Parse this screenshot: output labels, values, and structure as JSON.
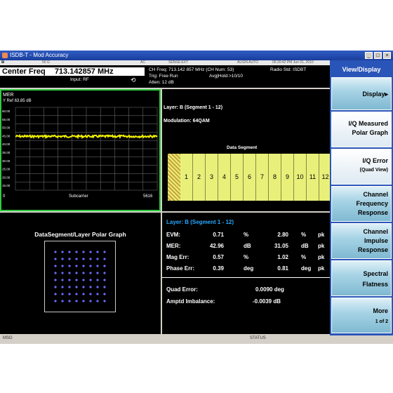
{
  "window": {
    "title": "ISDB-T - Mod Accuracy",
    "buttons": [
      "_",
      "□",
      "×"
    ]
  },
  "info_strip": {
    "mode": "50 Ω",
    "coupling": "AC",
    "sense": "SENSE:EXT",
    "align": "ALIGN AUTO",
    "datetime": "05:20:42 PM Jun 01, 2010"
  },
  "header": {
    "center_freq_label": "Center Freq",
    "center_freq_value": "713.142857 MHz",
    "input": "Input: RF",
    "ch_freq": "CH Freq: 713.142 857 MHz (CH Num: 53)",
    "trig": "Trig: Free Run",
    "atten": "Atten: 12 dB",
    "avg_hold": "Avg|Hold:>10/10",
    "radio_std": "Radio Std: ISDBT"
  },
  "mer_panel": {
    "title": "MER",
    "yref": "Y Ref  63.85 dB",
    "yticks": [
      "60.00",
      "55.00",
      "50.00",
      "45.00",
      "40.00",
      "35.00",
      "30.00",
      "25.00",
      "20.00",
      "15.00"
    ],
    "xlabel": "Subcarrier",
    "xmin": "0",
    "xmax": "5616",
    "trace_color": "#f2f200"
  },
  "segment_panel": {
    "layer": "Layer: B (Segment 1 - 12)",
    "modulation": "Modulation: 64QAM",
    "data_segment_label": "Data Segment",
    "segments": [
      "1",
      "2",
      "3",
      "4",
      "5",
      "6",
      "7",
      "8",
      "9",
      "10",
      "11",
      "12"
    ],
    "segment_color": "#e8f07a"
  },
  "polar_panel": {
    "title": "DataSegment/Layer Polar Graph",
    "dot_color": "#6a6aff"
  },
  "metrics_panel": {
    "layer": "Layer: B (Segment 1 - 12)",
    "rows": [
      {
        "label": "EVM:",
        "v1": "0.71",
        "u1": "%",
        "v2": "2.80",
        "u2": "%",
        "tag": "pk"
      },
      {
        "label": "MER:",
        "v1": "42.96",
        "u1": "dB",
        "v2": "31.05",
        "u2": "dB",
        "tag": "pk"
      },
      {
        "label": "Mag Err:",
        "v1": "0.57",
        "u1": "%",
        "v2": "1.02",
        "u2": "%",
        "tag": "pk"
      },
      {
        "label": "Phase Err:",
        "v1": "0.39",
        "u1": "deg",
        "v2": "0.81",
        "u2": "deg",
        "tag": "pk"
      }
    ],
    "quad_error_label": "Quad Error:",
    "quad_error_value": "0.0090 deg",
    "amptd_label": "Amptd Imbalance:",
    "amptd_value": "-0.0039 dB"
  },
  "softkeys": {
    "menu_title": "View/Display",
    "display": "Display",
    "iq_measured_1": "I/Q Measured",
    "iq_measured_2": "Polar Graph",
    "iq_error_1": "I/Q Error",
    "iq_error_2": "(Quad View)",
    "channel_freq_1": "Channel",
    "channel_freq_2": "Frequency",
    "channel_freq_3": "Response",
    "channel_imp_1": "Channel",
    "channel_imp_2": "Impulse",
    "channel_imp_3": "Response",
    "spectral_1": "Spectral",
    "spectral_2": "Flatness",
    "more_1": "More",
    "more_2": "1 of 2"
  },
  "statusbar": {
    "msg": "MSG",
    "status": "STATUS"
  }
}
